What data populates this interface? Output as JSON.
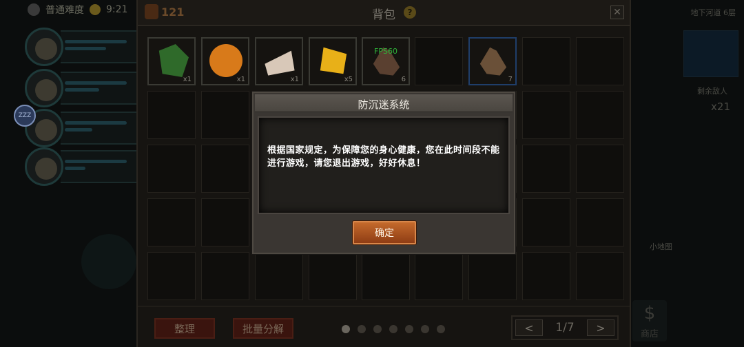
{
  "hud": {
    "difficulty_label": "普通难度",
    "timer": "9:21",
    "zzz_badge": "ZZZ",
    "floor_label": "地下河道 6层",
    "enemies_label": "剩余敌人",
    "enemies_count": "x21",
    "side_label": "小地图",
    "shop_label": "商店",
    "shop_icon": "dollar-icon"
  },
  "bag": {
    "title": "背包",
    "help_icon": "?",
    "gold_count": "121",
    "close_icon": "✕",
    "items": [
      {
        "name": "green-cloak",
        "qty": "x1",
        "color": "#2f6a2a"
      },
      {
        "name": "pumpkin",
        "qty": "x1",
        "color": "#d87a1a"
      },
      {
        "name": "cake-slice",
        "qty": "x1",
        "color": "#d8c8b8"
      },
      {
        "name": "cheese",
        "qty": "x5",
        "color": "#e8b018"
      },
      {
        "name": "wooden-sticks",
        "qty": "6",
        "color": "#5a4030"
      },
      {
        "name": "tree-branch",
        "qty": "7",
        "color": "#6a5038"
      }
    ],
    "fps_label": "FPS60",
    "sort_button": "整理",
    "batch_decompose_button": "批量分解",
    "page_dots": 7,
    "active_page_index": 0,
    "prev_label": "<",
    "next_label": ">",
    "page_label": "1/7"
  },
  "modal": {
    "title": "防沉迷系统",
    "message": "根据国家规定，为保障您的身心健康，您在此时间段不能进行游戏，请您退出游戏，好好休息！",
    "confirm_button": "确定"
  }
}
